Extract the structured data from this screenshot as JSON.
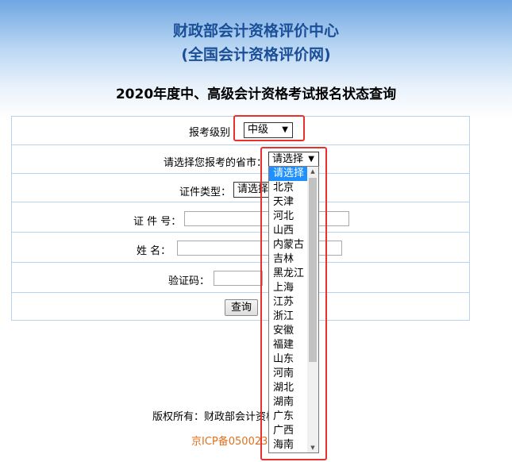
{
  "header": {
    "line1": "财政部会计资格评价中心",
    "line2": "(全国会计资格评价网)"
  },
  "query_title": "2020年度中、高级会计资格考试报名状态查询",
  "form": {
    "level_label": "报考级别",
    "level_value": "中级",
    "province_label": "请选择您报考的省市：",
    "province_value": "请选择",
    "id_type_label": "证件类型：",
    "id_type_value": "请选择",
    "id_number_label": "证 件 号：",
    "name_label": "姓  名：",
    "captcha_label": "验证码：",
    "query_button": "查询"
  },
  "dropdown_options": [
    "请选择",
    "北京",
    "天津",
    "河北",
    "山西",
    "内蒙古",
    "吉林",
    "黑龙江",
    "上海",
    "江苏",
    "浙江",
    "安徽",
    "福建",
    "山东",
    "河南",
    "湖北",
    "湖南",
    "广东",
    "广西",
    "海南"
  ],
  "footer": {
    "copyright": "版权所有：财政部会计资格评价中心",
    "icp": "京ICP备050023"
  },
  "colors": {
    "header_text": "#1a4f98",
    "highlight_box": "#e8312a",
    "selected_option": "#1e90ff",
    "icp_text": "#e07020"
  }
}
